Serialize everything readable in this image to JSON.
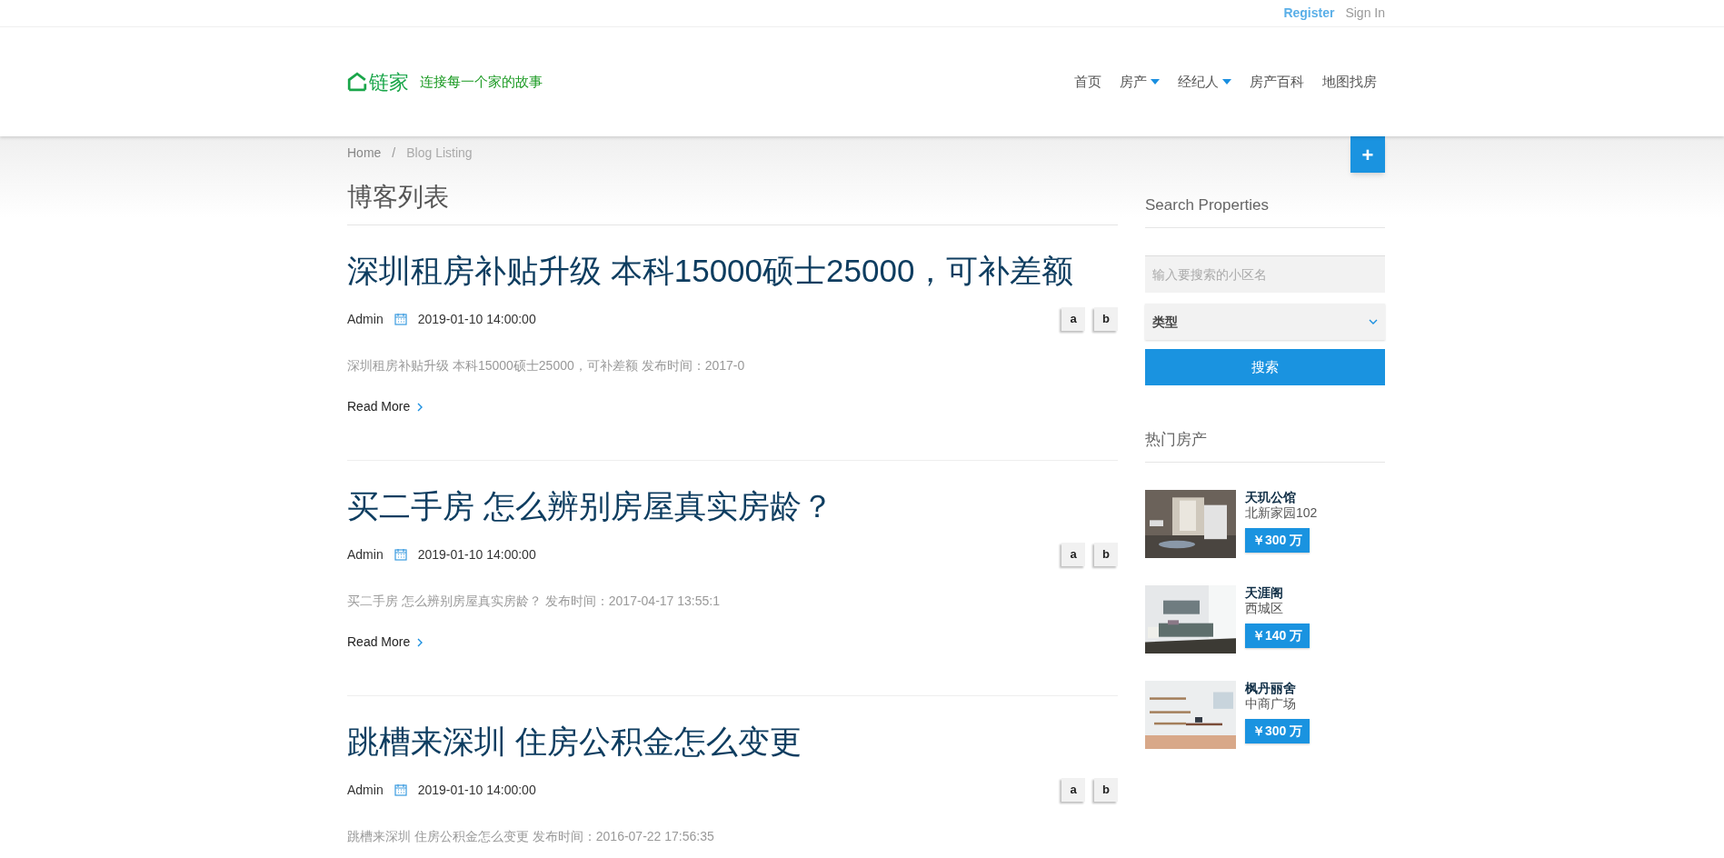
{
  "top_bar": {
    "links": [
      {
        "label": "Register",
        "selected": true
      },
      {
        "label": "Sign In",
        "selected": false
      }
    ]
  },
  "header": {
    "logo_text": "链家",
    "slogan": "连接每一个家的故事",
    "nav": [
      {
        "label": "首页",
        "dropdown": false
      },
      {
        "label": "房产",
        "dropdown": true
      },
      {
        "label": "经纪人",
        "dropdown": true
      },
      {
        "label": "房产百科",
        "dropdown": false
      },
      {
        "label": "地图找房",
        "dropdown": false
      }
    ]
  },
  "breadcrumb": {
    "home": "Home",
    "separator": "/",
    "current": "Blog Listing"
  },
  "add_button": "+",
  "page_title": "博客列表",
  "posts": [
    {
      "title": "深圳租房补贴升级 本科15000硕士25000，可补差额",
      "author": "Admin",
      "date": "2019-01-10 14:00:00",
      "buttons": [
        "a",
        "b"
      ],
      "excerpt": "深圳租房补贴升级 本科15000硕士25000，可补差额 发布时间：2017-0",
      "read_more": "Read More"
    },
    {
      "title": "买二手房 怎么辨别房屋真实房龄？",
      "author": "Admin",
      "date": "2019-01-10 14:00:00",
      "buttons": [
        "a",
        "b"
      ],
      "excerpt": "买二手房 怎么辨别房屋真实房龄？ 发布时间：2017-04-17 13:55:1",
      "read_more": "Read More"
    },
    {
      "title": "跳槽来深圳 住房公积金怎么变更",
      "author": "Admin",
      "date": "2019-01-10 14:00:00",
      "buttons": [
        "a",
        "b"
      ],
      "excerpt": "跳槽来深圳 住房公积金怎么变更 发布时间：2016-07-22 17:56:35"
    }
  ],
  "sidebar": {
    "search_title": "Search Properties",
    "search": {
      "placeholder": "输入要搜索的小区名"
    },
    "type_select": "类型",
    "search_button": "搜索",
    "hot_title": "热门房产",
    "properties": [
      {
        "name": "天玑公馆",
        "location": "北新家园102",
        "price": "￥300 万"
      },
      {
        "name": "天涯阁",
        "location": "西城区",
        "price": "￥140 万"
      },
      {
        "name": "枫丹丽舍",
        "location": "中商广场",
        "price": "￥300 万"
      }
    ]
  }
}
